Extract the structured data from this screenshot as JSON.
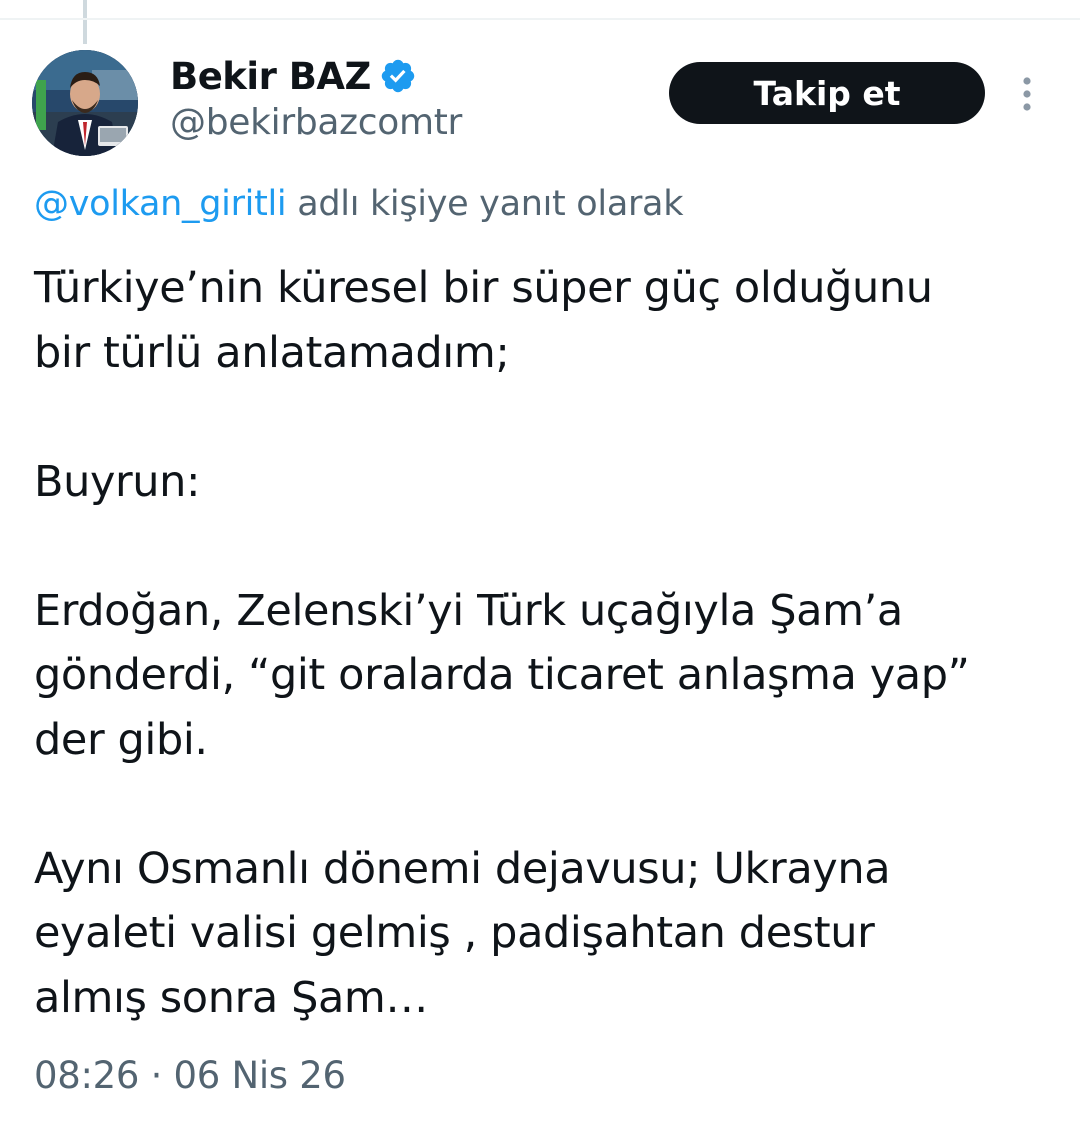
{
  "author": {
    "display_name": "Bekir BAZ",
    "handle": "@bekirbazcomtr",
    "verified": true,
    "avatar_icon": "profile-photo"
  },
  "actions": {
    "follow_label": "Takip et",
    "more_icon": "more-vertical-icon"
  },
  "reply_context": {
    "mention": "@volkan_giritli",
    "suffix": "adlı kişiye yanıt olarak"
  },
  "tweet": {
    "line1": "Türkiye’nin küresel bir süper güç olduğunu",
    "line2": "bir türlü anlatamadım;",
    "line3": "Buyrun:",
    "line4": "Erdoğan, Zelenski’yi Türk uçağıyla Şam’a",
    "line5": "gönderdi, “git oralarda ticaret anlaşma yap”",
    "line6": "der gibi.",
    "line7": "Aynı Osmanlı dönemi dejavusu; Ukrayna",
    "line8": "eyaleti valisi gelmiş , padişahtan destur",
    "line9": "almış sonra Şam…"
  },
  "timestamp": "08:26 · 06 Nis 26",
  "colors": {
    "text": "#0f1419",
    "secondary": "#536471",
    "link": "#1d9bf0",
    "verified": "#1d9bf0",
    "button_bg": "#0f1419"
  }
}
